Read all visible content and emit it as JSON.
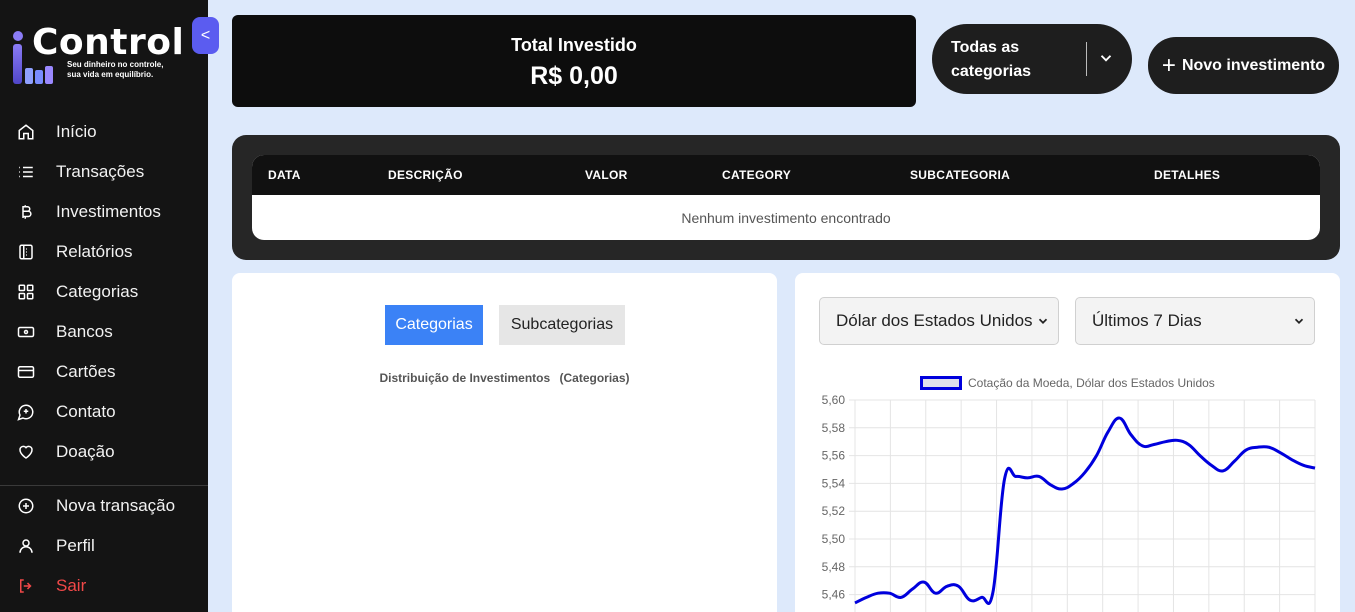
{
  "app": {
    "logo_word": "Control",
    "logo_tagline_1": "Seu dinheiro no controle,",
    "logo_tagline_2": "sua vida em equilíbrio.",
    "collapse_label": "<"
  },
  "sidebar": {
    "items": [
      {
        "label": "Início",
        "icon": "home-icon"
      },
      {
        "label": "Transações",
        "icon": "list-icon"
      },
      {
        "label": "Investimentos",
        "icon": "bitcoin-icon"
      },
      {
        "label": "Relatórios",
        "icon": "report-icon"
      },
      {
        "label": "Categorias",
        "icon": "grid-icon"
      },
      {
        "label": "Bancos",
        "icon": "bank-icon"
      },
      {
        "label": "Cartões",
        "icon": "card-icon"
      },
      {
        "label": "Contato",
        "icon": "chat-icon"
      },
      {
        "label": "Doação",
        "icon": "heart-icon"
      }
    ],
    "bottom_items": [
      {
        "label": "Nova transação",
        "icon": "plus-circle-icon"
      },
      {
        "label": "Perfil",
        "icon": "user-icon"
      },
      {
        "label": "Sair",
        "icon": "logout-icon"
      }
    ]
  },
  "header": {
    "total_title": "Total Investido",
    "total_value": "R$ 0,00",
    "category_filter_line1": "Todas as",
    "category_filter_line2": "categorias",
    "new_button_label": "Novo investimento"
  },
  "table": {
    "columns": [
      "DATA",
      "DESCRIÇÃO",
      "VALOR",
      "CATEGORY",
      "SUBCATEGORIA",
      "DETALHES"
    ],
    "empty_message": "Nenhum investimento encontrado"
  },
  "distribution": {
    "tabs": [
      "Categorias",
      "Subcategorias"
    ],
    "active_tab": "Categorias",
    "title": "Distribuição de Investimentos",
    "title_suffix": "(Categorias)"
  },
  "currency_panel": {
    "currency_selected": "Dólar dos Estados Unidos",
    "range_selected": "Últimos 7 Dias"
  },
  "colors": {
    "accent": "#3b82f6",
    "line": "#0000dd",
    "logout": "#f04848",
    "collapse": "#5b5cf0"
  },
  "chart_data": {
    "type": "line",
    "legend": "Cotação da Moeda, Dólar dos Estados Unidos",
    "ylim": [
      5.45,
      5.6
    ],
    "yticks": [
      "5,60",
      "5,58",
      "5,56",
      "5,54",
      "5,52",
      "5,50",
      "5,48",
      "5,46"
    ],
    "series": [
      {
        "name": "Cotação da Moeda, Dólar dos Estados Unidos",
        "values": [
          5.454,
          5.458,
          5.461,
          5.461,
          5.458,
          5.464,
          5.469,
          5.461,
          5.466,
          5.466,
          5.456,
          5.458,
          5.462,
          5.543,
          5.545,
          5.544,
          5.545,
          5.539,
          5.536,
          5.54,
          5.548,
          5.56,
          5.577,
          5.587,
          5.575,
          5.567,
          5.568,
          5.57,
          5.571,
          5.568,
          5.56,
          5.553,
          5.549,
          5.556,
          5.564,
          5.566,
          5.566,
          5.562,
          5.557,
          5.553,
          5.551
        ]
      }
    ]
  }
}
